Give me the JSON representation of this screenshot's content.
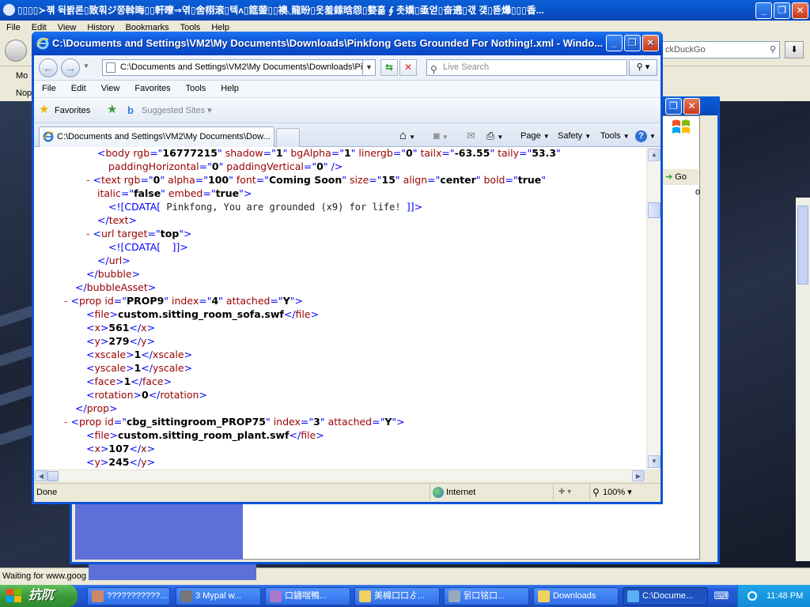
{
  "background_browser": {
    "title": "▯▯▯▯≻졖 뒥봙론▯致훠ジ쫑斡晦▯▯軒曢⇒엮▯舍栩滚▯텍ʌ▯筵蓥▯▯襖◟龍昐▯옷羞鎍晗怨▯婺훎 ∮ 촛嬌▯亟얻▯奋遶▯갟 갳▯뚇爗▯▯▯香...",
    "menu": [
      "File",
      "Edit",
      "View",
      "History",
      "Bookmarks",
      "Tools",
      "Help"
    ],
    "search_placeholder": "ckDuckGo",
    "tab1": "Mo",
    "tab2": "Nop",
    "status": "Waiting for www.goog"
  },
  "middle_window": {
    "go_label": "Go",
    "o_label": "o"
  },
  "ie": {
    "title": "C:\\Documents and Settings\\VM2\\My Documents\\Downloads\\Pinkfong Gets Grounded For Nothing!.xml - Windo...",
    "address": "C:\\Documents and Settings\\VM2\\My Documents\\Downloads\\Pinl",
    "search_placeholder": "Live Search",
    "menu": [
      "File",
      "Edit",
      "View",
      "Favorites",
      "Tools",
      "Help"
    ],
    "favorites_label": "Favorites",
    "suggested_sites": "Suggested Sites",
    "tab_title": "C:\\Documents and Settings\\VM2\\My Documents\\Dow...",
    "commands": {
      "page": "Page",
      "safety": "Safety",
      "tools": "Tools"
    },
    "status": {
      "done": "Done",
      "zone": "Internet",
      "zoom": "100%"
    }
  },
  "xml": {
    "body_attrs": {
      "rgb": "16777215",
      "shadow": "1",
      "bgAlpha": "1",
      "linergb": "0",
      "tailx": "-63.55",
      "taily": "53.3",
      "paddingHorizontal": "0",
      "paddingVertical": "0"
    },
    "text_attrs": {
      "rgb": "0",
      "alpha": "100",
      "font": "Coming Soon",
      "size": "15",
      "align": "center",
      "bold": "true",
      "italic": "false",
      "embed": "true"
    },
    "text_cdata": " Pinkfong, You are grounded (x9) for life! ",
    "url_target": "top",
    "url_cdata": "  ",
    "prop9": {
      "id": "PROP9",
      "index": "4",
      "attached": "Y",
      "file": "custom.sitting_room_sofa.swf",
      "x": "561",
      "y": "279",
      "xscale": "1",
      "yscale": "1",
      "face": "1",
      "rotation": "0"
    },
    "prop75": {
      "id": "cbg_sittingroom_PROP75",
      "index": "3",
      "attached": "Y",
      "file": "custom.sitting_room_plant.swf",
      "x": "107",
      "y": "245"
    }
  },
  "taskbar": {
    "start_label": "抗阢",
    "tasks": [
      "???????????...",
      "3 Mypal w...",
      "口鏽喘鴨...",
      "美櫞口口ゟ...",
      "뒭口铭口...",
      "Downloads",
      "C:\\Docume..."
    ],
    "clock": "11:48 PM"
  },
  "colors": {
    "xp_blue": "#0c54d6",
    "xml_markup": "#900",
    "xml_minus": "#e0202a",
    "xml_value": "#0000ff"
  }
}
